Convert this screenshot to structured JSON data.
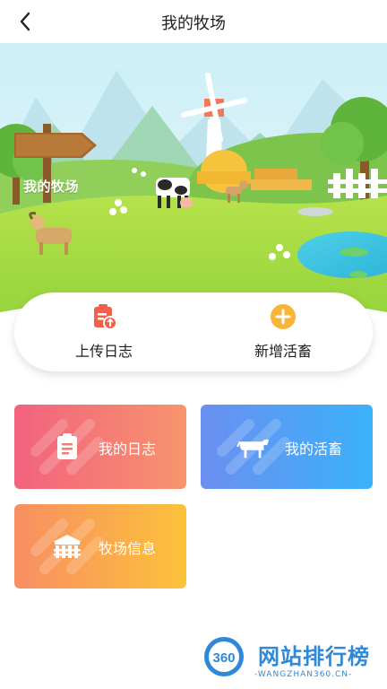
{
  "header": {
    "title": "我的牧场"
  },
  "banner": {
    "sign_text": "我的牧场"
  },
  "actions": {
    "upload_log": "上传日志",
    "add_livestock": "新增活畜"
  },
  "tiles": {
    "my_log": "我的日志",
    "my_livestock": "我的活畜",
    "ranch_info": "牧场信息"
  },
  "watermark": {
    "badge": "360",
    "title": "网站排行榜",
    "subtitle": "-WANGZHAN360.CN-"
  },
  "colors": {
    "log_gradient": [
      "#f2627e",
      "#f7946d"
    ],
    "livestock_gradient": [
      "#6b8ff0",
      "#3ab2fb"
    ],
    "ranch_gradient": [
      "#f88e63",
      "#fcc23a"
    ],
    "upload_icon": "#f0604a",
    "add_icon": "#f9b53a"
  }
}
